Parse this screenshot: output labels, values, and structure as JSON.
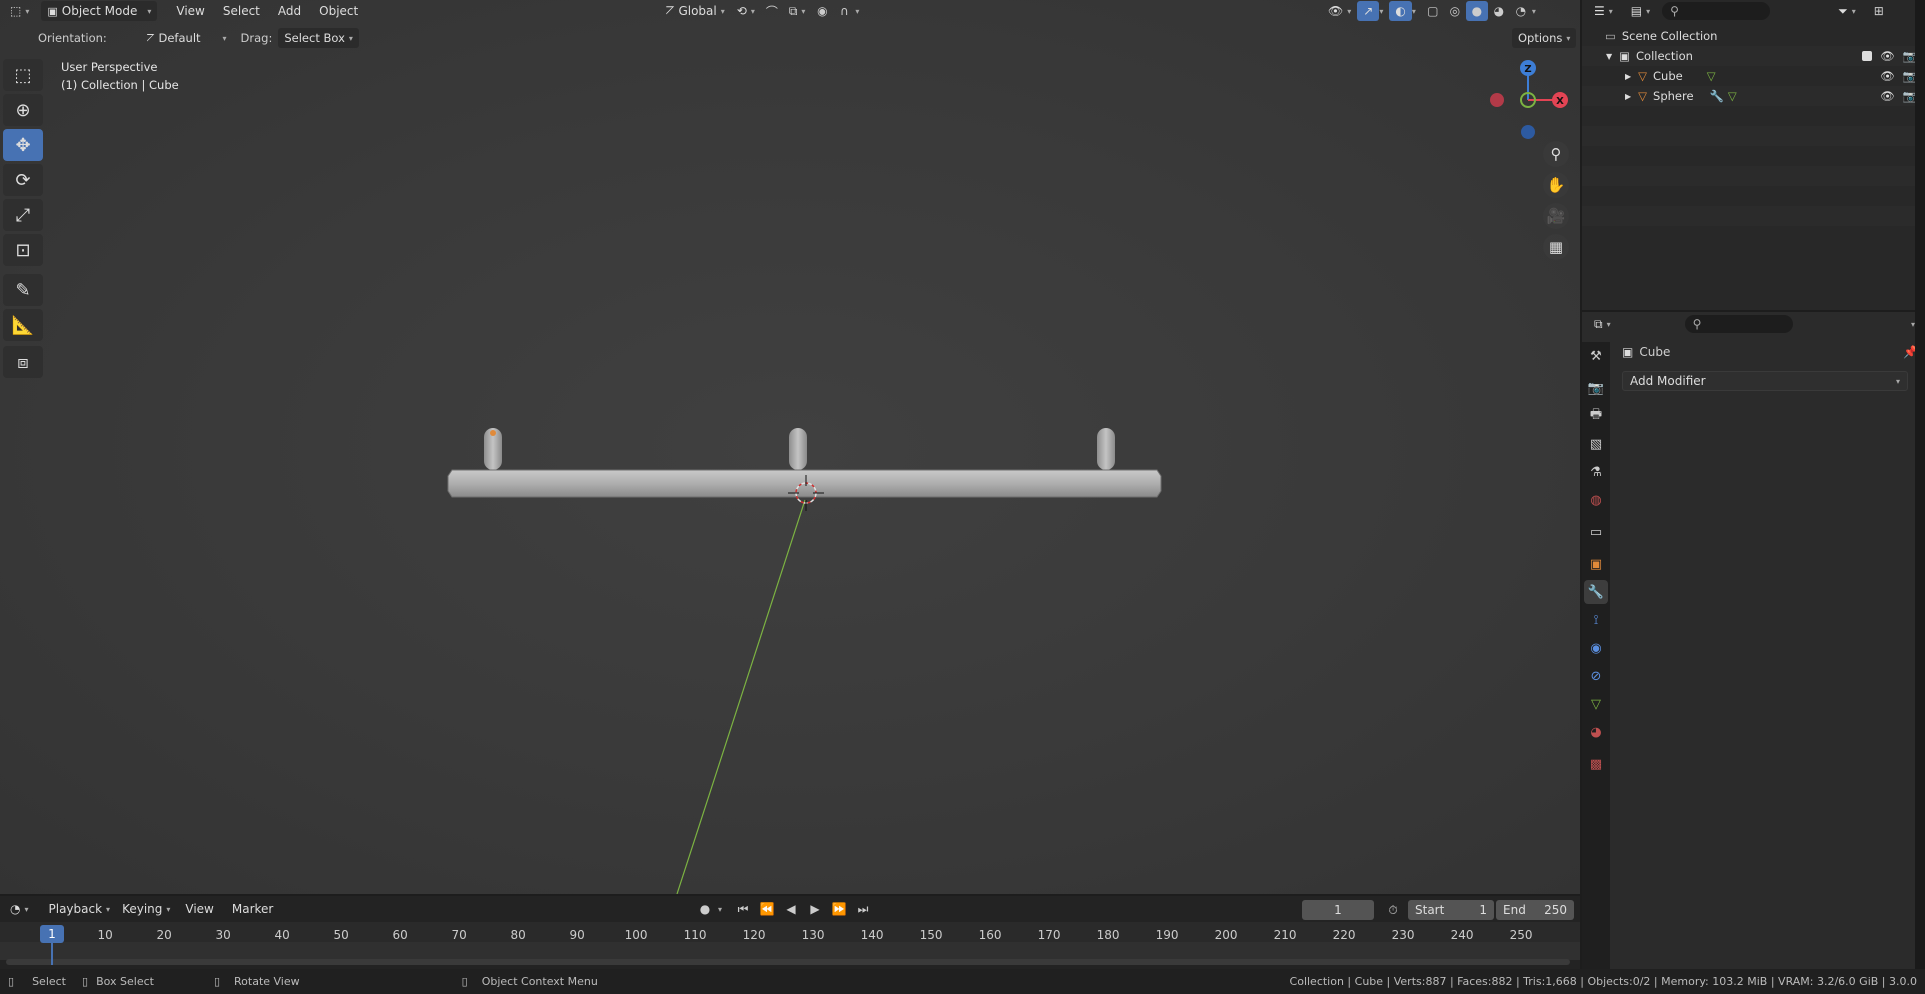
{
  "header": {
    "mode": "Object Mode",
    "menus": [
      "View",
      "Select",
      "Add",
      "Object"
    ],
    "transform_orientation": "Global"
  },
  "tool_settings": {
    "orientation_label": "Orientation:",
    "orientation_value": "Default",
    "drag_label": "Drag:",
    "drag_value": "Select Box",
    "options_label": "Options"
  },
  "viewport": {
    "view_name": "User Perspective",
    "context": "(1) Collection | Cube",
    "gizmo": {
      "z": "Z",
      "x": "X"
    }
  },
  "outliner": {
    "root": "Scene Collection",
    "collection": "Collection",
    "items": [
      {
        "name": "Cube"
      },
      {
        "name": "Sphere"
      }
    ]
  },
  "properties": {
    "object_name": "Cube",
    "add_modifier_label": "Add Modifier"
  },
  "timeline": {
    "menus": [
      "Playback",
      "Keying",
      "View",
      "Marker"
    ],
    "current_frame": "1",
    "start_label": "Start",
    "start_value": "1",
    "end_label": "End",
    "end_value": "250",
    "frame_marker": "1",
    "ticks": [
      "10",
      "20",
      "30",
      "40",
      "50",
      "60",
      "70",
      "80",
      "90",
      "100",
      "110",
      "120",
      "130",
      "140",
      "150",
      "160",
      "170",
      "180",
      "190",
      "200",
      "210",
      "220",
      "230",
      "240",
      "250"
    ]
  },
  "status_bar": {
    "select": "Select",
    "box_select": "Box Select",
    "rotate_view": "Rotate View",
    "context_menu": "Object Context Menu",
    "stats": "Collection | Cube | Verts:887 | Faces:882 | Tris:1,668 | Objects:0/2 | Memory: 103.2 MiB | VRAM: 3.2/6.0 GiB | 3.0.0"
  },
  "colors": {
    "accent": "#4772b3",
    "x_axis": "#e34454",
    "y_axis": "#7cb342",
    "z_axis": "#3d7ed6",
    "mesh_orange": "#e08a3a"
  }
}
